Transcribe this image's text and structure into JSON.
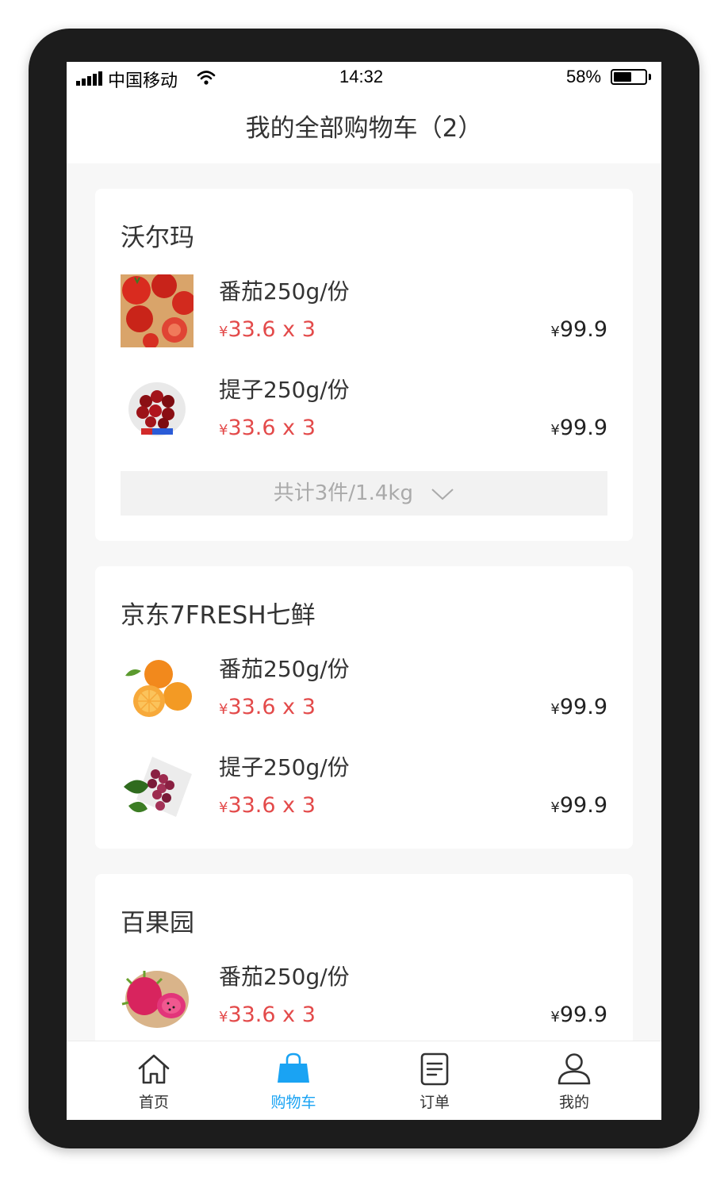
{
  "status_bar": {
    "carrier": "中国移动",
    "time": "14:32",
    "battery": "58%",
    "battery_level": 0.58
  },
  "header": {
    "title": "我的全部购物车（2）"
  },
  "stores": [
    {
      "name": "沃尔玛",
      "items": [
        {
          "name": "番茄250g/份",
          "unit_price": "¥33.6 x 3",
          "total": "¥99.9",
          "icon": "tomato-image"
        },
        {
          "name": "提子250g/份",
          "unit_price": "¥33.6 x 3",
          "total": "¥99.9",
          "icon": "cherry-image"
        }
      ],
      "summary": "共计3件/1.4kg"
    },
    {
      "name": "京东7FRESH七鲜",
      "items": [
        {
          "name": "番茄250g/份",
          "unit_price": "¥33.6 x 3",
          "total": "¥99.9",
          "icon": "orange-image"
        },
        {
          "name": "提子250g/份",
          "unit_price": "¥33.6 x 3",
          "total": "¥99.9",
          "icon": "grape-image"
        }
      ]
    },
    {
      "name": "百果园",
      "items": [
        {
          "name": "番茄250g/份",
          "unit_price": "¥33.6 x 3",
          "total": "¥99.9",
          "icon": "dragonfruit-image"
        }
      ]
    }
  ],
  "tabbar": {
    "active": "购物车",
    "accent": "#1aa3f3",
    "tabs": [
      {
        "label": "首页",
        "icon": "home-icon"
      },
      {
        "label": "购物车",
        "icon": "shopping-bag-icon"
      },
      {
        "label": "订单",
        "icon": "order-icon"
      },
      {
        "label": "我的",
        "icon": "user-icon"
      }
    ]
  },
  "colors": {
    "price_red": "#e34a4a",
    "background": "#f7f7f7"
  }
}
